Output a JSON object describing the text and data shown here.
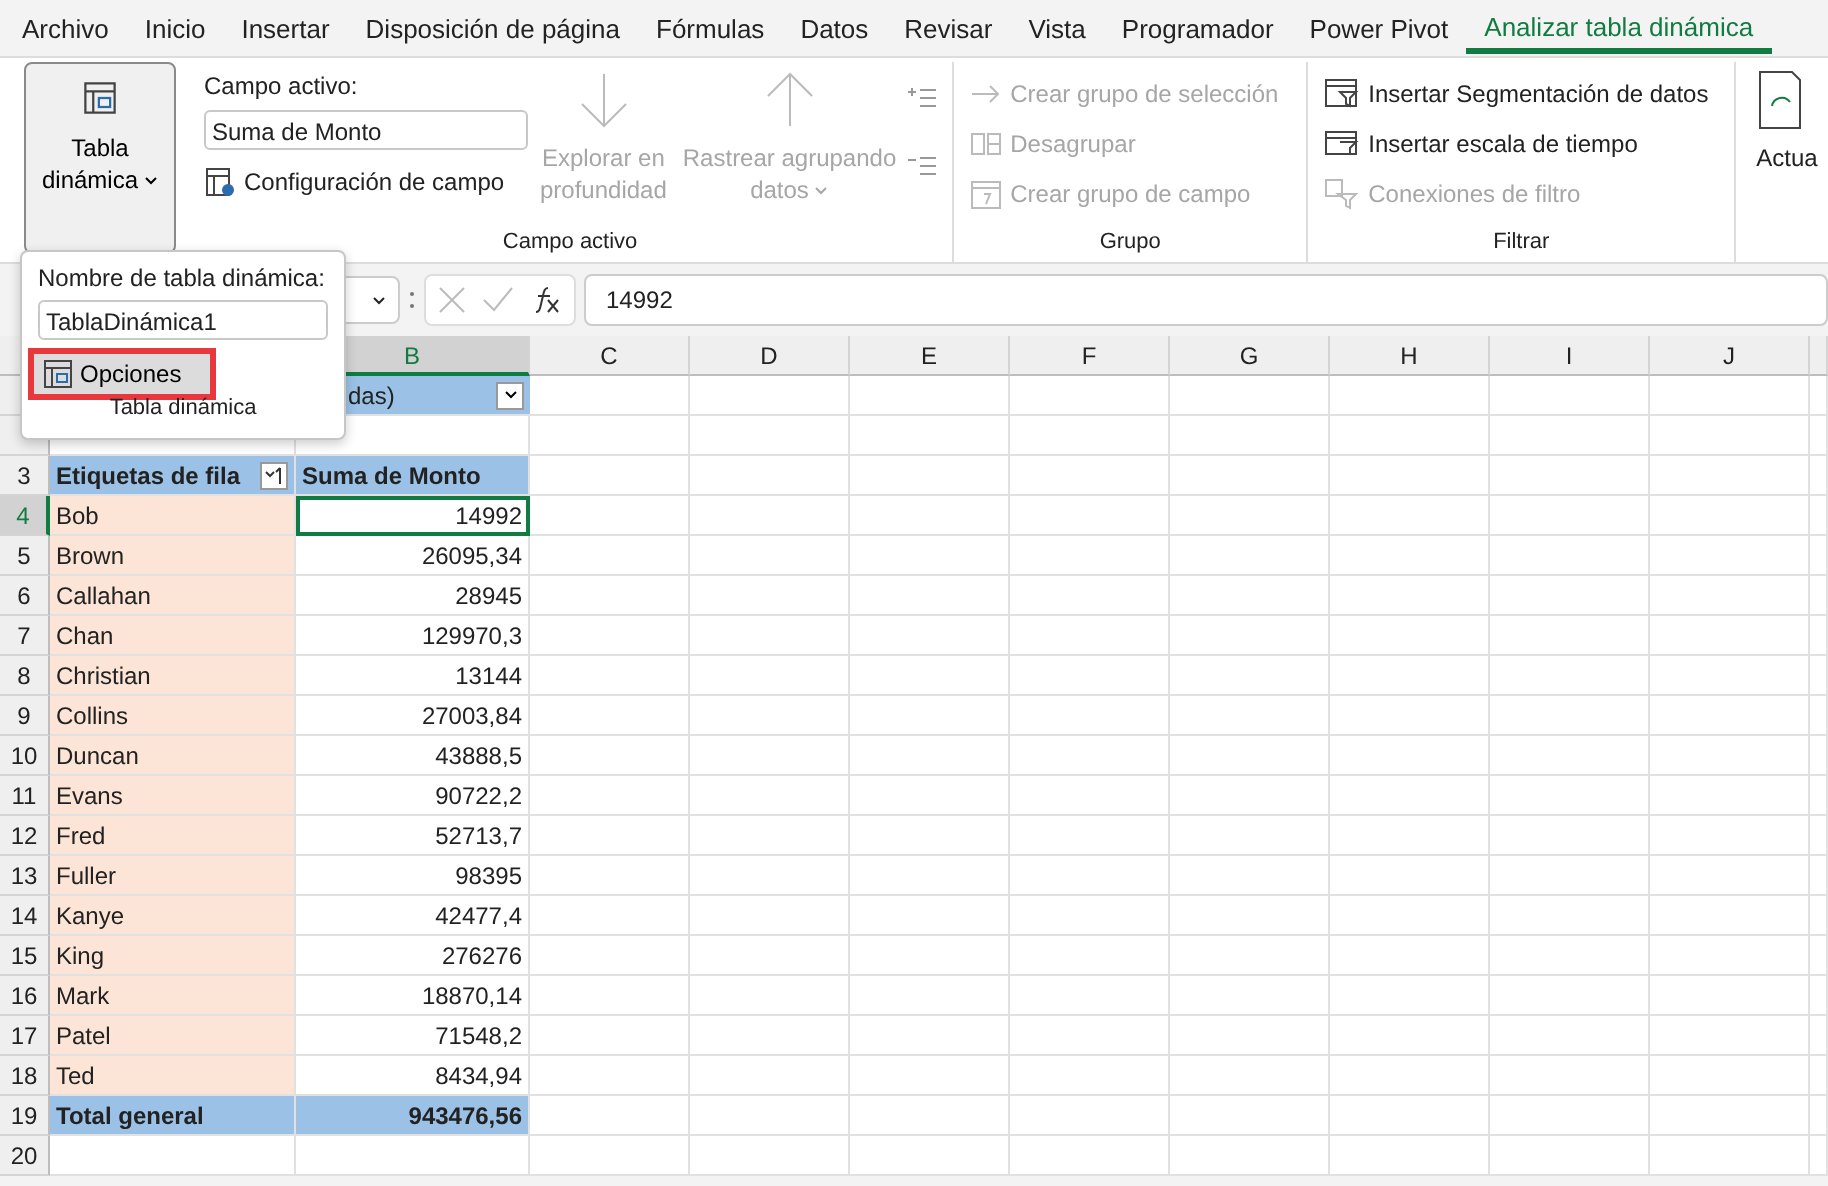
{
  "menu_tabs": [
    {
      "label": "Archivo",
      "selected": false
    },
    {
      "label": "Inicio",
      "selected": false
    },
    {
      "label": "Insertar",
      "selected": false
    },
    {
      "label": "Disposición de página",
      "selected": false
    },
    {
      "label": "Fórmulas",
      "selected": false
    },
    {
      "label": "Datos",
      "selected": false
    },
    {
      "label": "Revisar",
      "selected": false
    },
    {
      "label": "Vista",
      "selected": false
    },
    {
      "label": "Programador",
      "selected": false
    },
    {
      "label": "Power Pivot",
      "selected": false
    },
    {
      "label": "Analizar tabla dinámica",
      "selected": true
    }
  ],
  "ribbon": {
    "pivot_button": {
      "lines": [
        "Tabla",
        "dinámica"
      ]
    },
    "active_field": {
      "label": "Campo activo:",
      "value": "Suma de Monto",
      "settings_button": "Configuración de campo",
      "drill_down": {
        "lines": [
          "Explorar en",
          "profundidad"
        ],
        "disabled": true
      },
      "drill_up": {
        "lines": [
          "Rastrear agrupando",
          "datos"
        ],
        "disabled": true
      },
      "title": "Campo activo"
    },
    "group": {
      "items": [
        {
          "kind": "selection",
          "label": "Crear grupo de selección",
          "disabled": true
        },
        {
          "kind": "ungroup",
          "label": "Desagrupar",
          "disabled": true
        },
        {
          "kind": "field",
          "label": "Crear grupo de campo",
          "disabled": true
        }
      ],
      "title": "Grupo"
    },
    "filter": {
      "items": [
        {
          "kind": "slicer",
          "label": "Insertar Segmentación de datos",
          "disabled": false
        },
        {
          "kind": "timeline",
          "label": "Insertar escala de tiempo",
          "disabled": false
        },
        {
          "kind": "connections",
          "label": "Conexiones de filtro",
          "disabled": true
        }
      ],
      "title": "Filtrar"
    },
    "refresh": {
      "label": "Actua"
    }
  },
  "popup": {
    "label": "Nombre de tabla dinámica:",
    "name_value": "TablaDinámica1",
    "options_button": "Opciones",
    "title": "Tabla dinámica"
  },
  "formula_bar": {
    "value": "14992"
  },
  "sheet": {
    "columns": [
      {
        "label": "B",
        "selected": true
      },
      {
        "label": "C",
        "selected": false
      },
      {
        "label": "D",
        "selected": false
      },
      {
        "label": "E",
        "selected": false
      },
      {
        "label": "F",
        "selected": false
      },
      {
        "label": "G",
        "selected": false
      },
      {
        "label": "H",
        "selected": false
      },
      {
        "label": "I",
        "selected": false
      },
      {
        "label": "J",
        "selected": false
      }
    ],
    "rows": [
      {
        "kind": "filter",
        "b": "das)"
      },
      {
        "kind": "empty"
      },
      {
        "row": "3",
        "kind": "header",
        "a": "Etiquetas de fila",
        "b": "Suma de Monto"
      },
      {
        "row": "4",
        "kind": "item",
        "a": "Bob",
        "b": "14992",
        "selected": true
      },
      {
        "row": "5",
        "kind": "item",
        "a": "Brown",
        "b": "26095,34",
        "selected": false
      },
      {
        "row": "6",
        "kind": "item",
        "a": "Callahan",
        "b": "28945",
        "selected": false
      },
      {
        "row": "7",
        "kind": "item",
        "a": "Chan",
        "b": "129970,3",
        "selected": false
      },
      {
        "row": "8",
        "kind": "item",
        "a": "Christian",
        "b": "13144",
        "selected": false
      },
      {
        "row": "9",
        "kind": "item",
        "a": "Collins",
        "b": "27003,84",
        "selected": false
      },
      {
        "row": "10",
        "kind": "item",
        "a": "Duncan",
        "b": "43888,5",
        "selected": false
      },
      {
        "row": "11",
        "kind": "item",
        "a": "Evans",
        "b": "90722,2",
        "selected": false
      },
      {
        "row": "12",
        "kind": "item",
        "a": "Fred",
        "b": "52713,7",
        "selected": false
      },
      {
        "row": "13",
        "kind": "item",
        "a": "Fuller",
        "b": "98395",
        "selected": false
      },
      {
        "row": "14",
        "kind": "item",
        "a": "Kanye",
        "b": "42477,4",
        "selected": false
      },
      {
        "row": "15",
        "kind": "item",
        "a": "King",
        "b": "276276",
        "selected": false
      },
      {
        "row": "16",
        "kind": "item",
        "a": "Mark",
        "b": "18870,14",
        "selected": false
      },
      {
        "row": "17",
        "kind": "item",
        "a": "Patel",
        "b": "71548,2",
        "selected": false
      },
      {
        "row": "18",
        "kind": "item",
        "a": "Ted",
        "b": "8434,94",
        "selected": false
      },
      {
        "row": "19",
        "kind": "total",
        "a": "Total general",
        "b": "943476,56"
      },
      {
        "row": "20",
        "kind": "empty"
      }
    ]
  }
}
